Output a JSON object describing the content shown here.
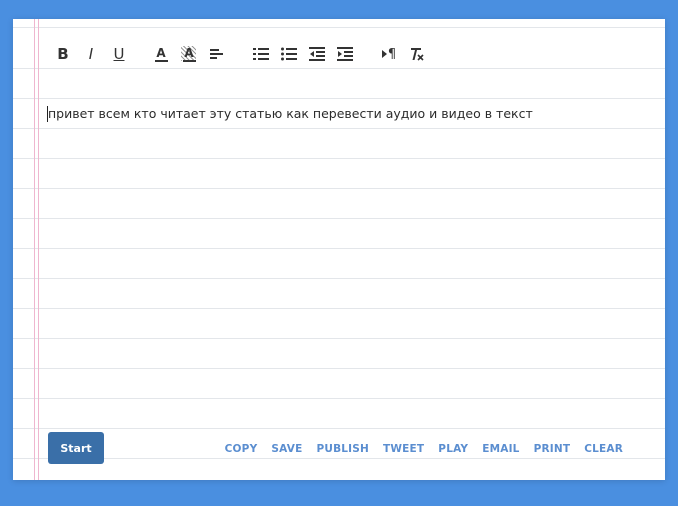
{
  "toolbar": {
    "bold": "B",
    "italic": "I",
    "underline": "U",
    "font_color": "A",
    "highlight_color": "A",
    "paragraph_mark": "¶"
  },
  "editor": {
    "text": "привет всем кто читает эту статью как перевести аудио и видео в текст"
  },
  "buttons": {
    "start": "Start"
  },
  "actions": [
    "COPY",
    "SAVE",
    "PUBLISH",
    "TWEET",
    "PLAY",
    "EMAIL",
    "PRINT",
    "CLEAR"
  ],
  "colors": {
    "background": "#4a8fe0",
    "start_button": "#3a6fa8",
    "action_link": "#5b8ed0",
    "margin_line": "#efb6cf"
  }
}
